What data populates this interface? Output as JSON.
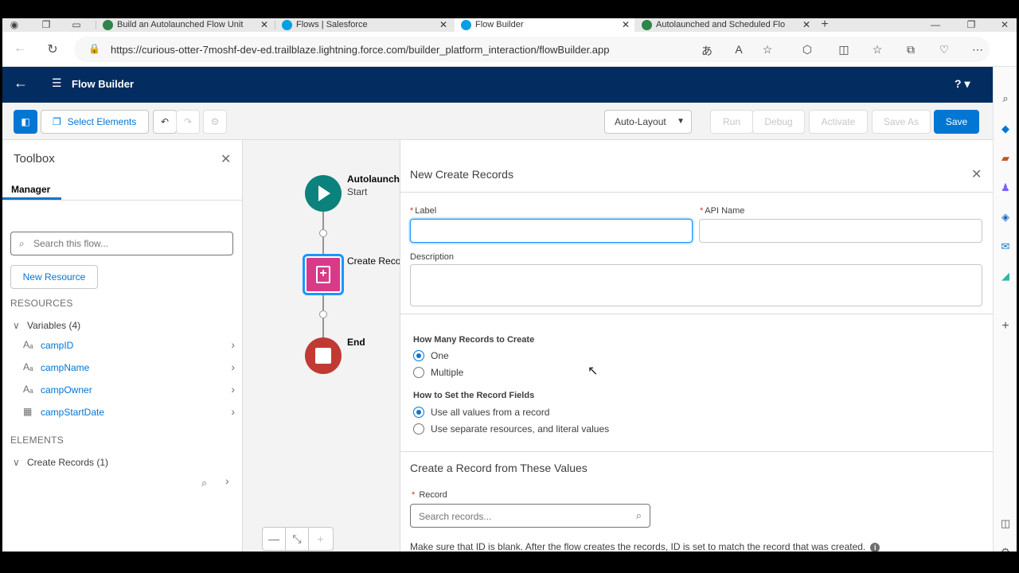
{
  "browser": {
    "tabs": [
      {
        "title": "Build an Autolaunched Flow Unit",
        "active": false
      },
      {
        "title": "Flows | Salesforce",
        "active": false
      },
      {
        "title": "Flow Builder",
        "active": true
      },
      {
        "title": "Autolaunched and Scheduled Flo",
        "active": false
      }
    ],
    "url": "https://curious-otter-7moshf-dev-ed.trailblaze.lightning.force.com/builder_platform_interaction/flowBuilder.app"
  },
  "header": {
    "app_title": "Flow Builder",
    "help": "?"
  },
  "toolbar": {
    "select_elements": "Select Elements",
    "layout_mode": "Auto-Layout",
    "run": "Run",
    "debug": "Debug",
    "activate": "Activate",
    "save_as": "Save As",
    "save": "Save"
  },
  "toolbox": {
    "title": "Toolbox",
    "tab": "Manager",
    "search_placeholder": "Search this flow...",
    "new_resource": "New Resource",
    "resources_heading": "RESOURCES",
    "variables_group": "Variables (4)",
    "variables": [
      {
        "name": "campID",
        "icon": "text-type-icon"
      },
      {
        "name": "campName",
        "icon": "text-type-icon"
      },
      {
        "name": "campOwner",
        "icon": "text-type-icon"
      },
      {
        "name": "campStartDate",
        "icon": "calendar-icon"
      }
    ],
    "elements_heading": "ELEMENTS",
    "elements_group": "Create Records (1)"
  },
  "canvas": {
    "start_label": "Autolaunche",
    "start_sub": "Start",
    "create_label": "Create Recor",
    "end_label": "End"
  },
  "panel": {
    "title": "New Create Records",
    "label_field": {
      "label": "Label",
      "value": ""
    },
    "api_name_field": {
      "label": "API Name",
      "value": ""
    },
    "description_label": "Description",
    "how_many_heading": "How Many Records to Create",
    "how_many_options": [
      {
        "label": "One",
        "selected": true
      },
      {
        "label": "Multiple",
        "selected": false
      }
    ],
    "how_set_heading": "How to Set the Record Fields",
    "how_set_options": [
      {
        "label": "Use all values from a record",
        "selected": true
      },
      {
        "label": "Use separate resources, and literal values",
        "selected": false
      }
    ],
    "section_title": "Create a Record from These Values",
    "record_label": "Record",
    "record_placeholder": "Search records...",
    "help_text": "Make sure that ID is blank. After the flow creates the records, ID is set to match the record that was created."
  },
  "colors": {
    "header": "#032d60",
    "brand": "#0176d3",
    "start_node": "#0b827c",
    "create_node": "#d83a88",
    "end_node": "#c23934"
  }
}
